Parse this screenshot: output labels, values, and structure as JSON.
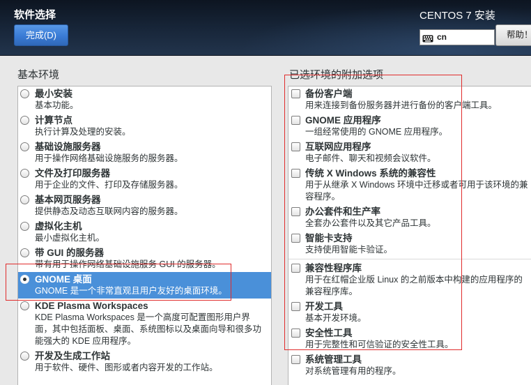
{
  "header": {
    "title": "软件选择",
    "done_button": "完成(D)",
    "product": "CENTOS 7 安装",
    "keyboard_layout": "cn",
    "help_button": "帮助！"
  },
  "icons": {
    "keyboard": "keyboard-icon"
  },
  "environments": {
    "label": "基本环境",
    "items": [
      {
        "name": "最小安装",
        "desc": "基本功能。",
        "selected": false
      },
      {
        "name": "计算节点",
        "desc": "执行计算及处理的安装。",
        "selected": false
      },
      {
        "name": "基础设施服务器",
        "desc": "用于操作网络基础设施服务的服务器。",
        "selected": false
      },
      {
        "name": "文件及打印服务器",
        "desc": "用于企业的文件、打印及存储服务器。",
        "selected": false
      },
      {
        "name": "基本网页服务器",
        "desc": "提供静态及动态互联网内容的服务器。",
        "selected": false
      },
      {
        "name": "虚拟化主机",
        "desc": "最小虚拟化主机。",
        "selected": false
      },
      {
        "name": "带 GUI 的服务器",
        "desc": "带有用于操作网络基础设施服务 GUI 的服务器。",
        "selected": false
      },
      {
        "name": "GNOME 桌面",
        "desc": "GNOME 是一个非常直观且用户友好的桌面环境。",
        "selected": true
      },
      {
        "name": "KDE Plasma Workspaces",
        "desc": "KDE Plasma Workspaces 是一个高度可配置图形用户界面，其中包括面板、桌面、系统图标以及桌面向导和很多功能强大的 KDE 应用程序。",
        "selected": false
      },
      {
        "name": "开发及生成工作站",
        "desc": "用于软件、硬件、图形或者内容开发的工作站。",
        "selected": false
      }
    ]
  },
  "addons": {
    "label": "已选环境的附加选项",
    "items": [
      {
        "name": "备份客户端",
        "desc": "用来连接到备份服务器并进行备份的客户端工具。",
        "checked": false
      },
      {
        "name": "GNOME 应用程序",
        "desc": "一组经常使用的 GNOME 应用程序。",
        "checked": false
      },
      {
        "name": "互联网应用程序",
        "desc": "电子邮件、聊天和视频会议软件。",
        "checked": false
      },
      {
        "name": "传统 X Windows 系统的兼容性",
        "desc": "用于从继承 X Windows 环境中迁移或者可用于该环境的兼容程序。",
        "checked": false
      },
      {
        "name": "办公套件和生产率",
        "desc": "全套办公套件以及其它产品工具。",
        "checked": false
      },
      {
        "name": "智能卡支持",
        "desc": "支持使用智能卡验证。",
        "checked": false
      },
      {
        "name": "兼容性程序库",
        "desc": "用于在红帽企业版 Linux 的之前版本中构建的应用程序的兼容程序库。",
        "checked": false
      },
      {
        "name": "开发工具",
        "desc": "基本开发环境。",
        "checked": false
      },
      {
        "name": "安全性工具",
        "desc": "用于完整性和可信验证的安全性工具。",
        "checked": false
      },
      {
        "name": "系统管理工具",
        "desc": "对系统管理有用的程序。",
        "checked": false
      }
    ]
  },
  "colors": {
    "selection": "#4a90d9",
    "done_button": "#3a7bd5",
    "annotation": "#e02b2b"
  }
}
